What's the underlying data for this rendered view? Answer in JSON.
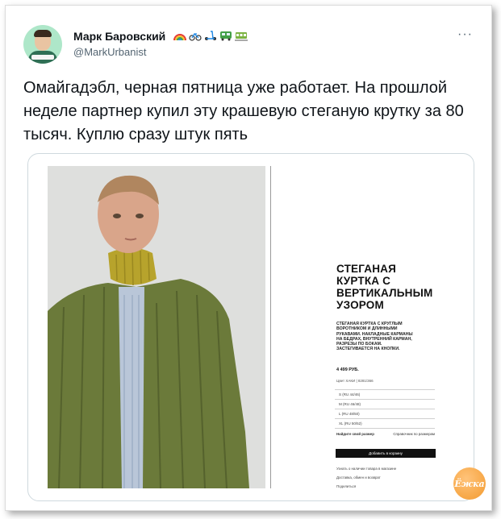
{
  "tweet": {
    "display_name": "Марк Баровский",
    "name_emojis": [
      "rainbow-icon",
      "bicycle-icon",
      "scooter-icon",
      "bus-icon",
      "tram-icon"
    ],
    "handle": "@MarkUrbanist",
    "more_label": "···",
    "text": "Омайгадэбл, черная пятница уже работает. На прошлой неделе партнер купил эту крашевую стеганую крутку за 80 тысяч. Куплю сразу штук пять"
  },
  "product": {
    "title": "СТЕГАНАЯ\nКУРТКА С\nВЕРТИКАЛЬНЫМ\nУЗОРОМ",
    "description": "СТЕГАНАЯ КУРТКА С КРУГЛЫМ\nВОРОТНИКОМ И ДЛИННЫМИ\nРУКАВАМИ. НАКЛАДНЫЕ КАРМАНЫ\nНА БЕДРАХ, ВНУТРЕННИЙ КАРМАН,\nРАЗРЕЗЫ ПО БОКАМ.\nЗАСТЕГИВАЕТСЯ НА КНОПКИ.",
    "price": "4 499 РУБ.",
    "article": "Цвет ХАКИ | 8281/366",
    "sizes": [
      "S (RU 44/46)",
      "M (RU 46/48)",
      "L (RU 48/50)",
      "XL (RU 50/52)"
    ],
    "find_size": "Найдите свой размер",
    "size_guide": "Справочник по размерам",
    "add_to_cart": "Добавить в корзину",
    "links": [
      "Узнать о наличии товара в магазине",
      "Доставка, обмен и возврат",
      "Поделиться"
    ]
  },
  "watermark": "Ёжка",
  "colors": {
    "text": "#0f1419",
    "secondary": "#536471",
    "jacket": "#6b7a3a",
    "scarf": "#b7a32c"
  }
}
